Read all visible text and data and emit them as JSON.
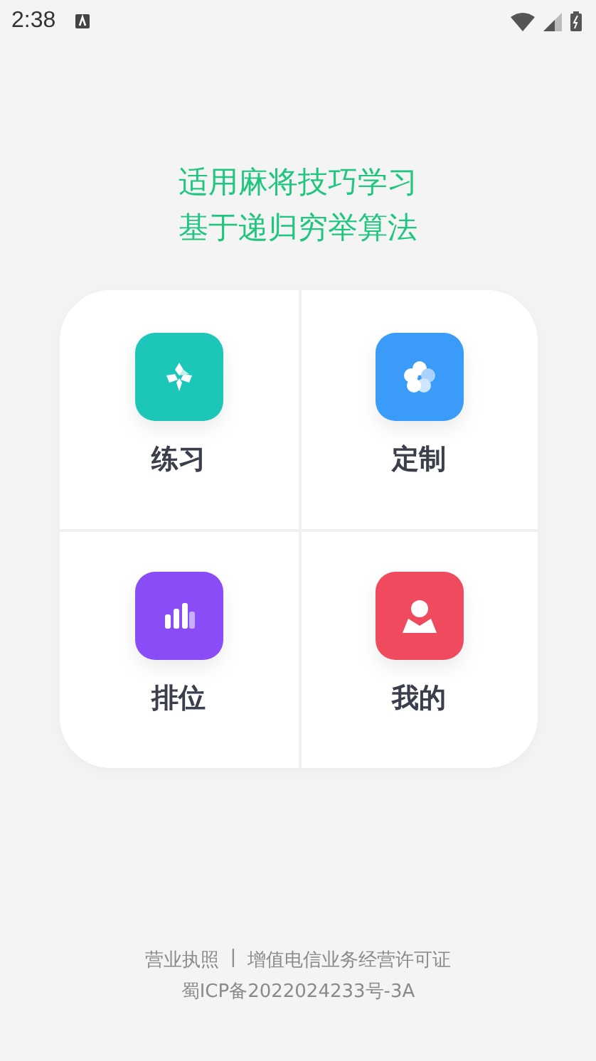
{
  "status_bar": {
    "time": "2:38"
  },
  "headline": [
    "适用麻将技巧学习",
    "基于递归穷举算法"
  ],
  "tiles": [
    {
      "label": "练习",
      "kind": "practice",
      "color": "#1cc6b9"
    },
    {
      "label": "定制",
      "kind": "custom",
      "color": "#3a9bf8"
    },
    {
      "label": "排位",
      "kind": "ranking",
      "color": "#8a4cf7"
    },
    {
      "label": "我的",
      "kind": "profile",
      "color": "#f04a5f"
    }
  ],
  "footer": {
    "links": [
      "营业执照",
      "增值电信业务经营许可证"
    ],
    "separator": "|",
    "record": "蜀ICP备2022024233号-3A"
  }
}
